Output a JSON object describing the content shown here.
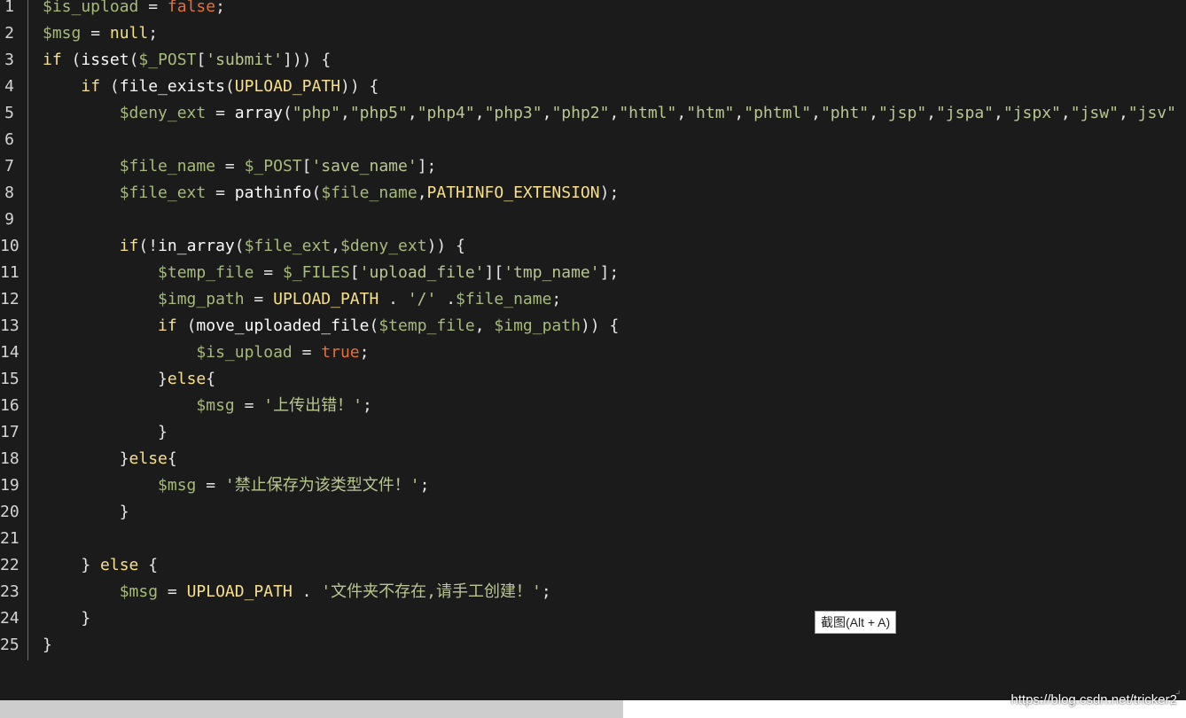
{
  "editor": {
    "line_numbers": [
      "1",
      "2",
      "3",
      "4",
      "5",
      "6",
      "7",
      "8",
      "9",
      "10",
      "11",
      "12",
      "13",
      "14",
      "15",
      "16",
      "17",
      "18",
      "19",
      "20",
      "21",
      "22",
      "23",
      "24",
      "25"
    ],
    "lines": [
      [
        [
          "var",
          "$is_upload"
        ],
        [
          "pn",
          " = "
        ],
        [
          "bool",
          "false"
        ],
        [
          "pn",
          ";"
        ]
      ],
      [
        [
          "var",
          "$msg"
        ],
        [
          "pn",
          " = "
        ],
        [
          "null",
          "null"
        ],
        [
          "pn",
          ";"
        ]
      ],
      [
        [
          "kw",
          "if"
        ],
        [
          "pn",
          " ("
        ],
        [
          "fn",
          "isset"
        ],
        [
          "pn",
          "("
        ],
        [
          "var",
          "$_POST"
        ],
        [
          "pn",
          "["
        ],
        [
          "str",
          "'submit'"
        ],
        [
          "pn",
          "])) {"
        ]
      ],
      [
        [
          "pn",
          "    "
        ],
        [
          "kw",
          "if"
        ],
        [
          "pn",
          " ("
        ],
        [
          "fn",
          "file_exists"
        ],
        [
          "pn",
          "("
        ],
        [
          "const",
          "UPLOAD_PATH"
        ],
        [
          "pn",
          ")) {"
        ]
      ],
      [
        [
          "pn",
          "        "
        ],
        [
          "var",
          "$deny_ext"
        ],
        [
          "pn",
          " = "
        ],
        [
          "fn",
          "array"
        ],
        [
          "pn",
          "("
        ],
        [
          "str",
          "\"php\""
        ],
        [
          "pn",
          ","
        ],
        [
          "str",
          "\"php5\""
        ],
        [
          "pn",
          ","
        ],
        [
          "str",
          "\"php4\""
        ],
        [
          "pn",
          ","
        ],
        [
          "str",
          "\"php3\""
        ],
        [
          "pn",
          ","
        ],
        [
          "str",
          "\"php2\""
        ],
        [
          "pn",
          ","
        ],
        [
          "str",
          "\"html\""
        ],
        [
          "pn",
          ","
        ],
        [
          "str",
          "\"htm\""
        ],
        [
          "pn",
          ","
        ],
        [
          "str",
          "\"phtml\""
        ],
        [
          "pn",
          ","
        ],
        [
          "str",
          "\"pht\""
        ],
        [
          "pn",
          ","
        ],
        [
          "str",
          "\"jsp\""
        ],
        [
          "pn",
          ","
        ],
        [
          "str",
          "\"jspa\""
        ],
        [
          "pn",
          ","
        ],
        [
          "str",
          "\"jspx\""
        ],
        [
          "pn",
          ","
        ],
        [
          "str",
          "\"jsw\""
        ],
        [
          "pn",
          ","
        ],
        [
          "str",
          "\"jsv\""
        ]
      ],
      [],
      [
        [
          "pn",
          "        "
        ],
        [
          "var",
          "$file_name"
        ],
        [
          "pn",
          " = "
        ],
        [
          "var",
          "$_POST"
        ],
        [
          "pn",
          "["
        ],
        [
          "str",
          "'save_name'"
        ],
        [
          "pn",
          "];"
        ]
      ],
      [
        [
          "pn",
          "        "
        ],
        [
          "var",
          "$file_ext"
        ],
        [
          "pn",
          " = "
        ],
        [
          "fn",
          "pathinfo"
        ],
        [
          "pn",
          "("
        ],
        [
          "var",
          "$file_name"
        ],
        [
          "pn",
          ","
        ],
        [
          "const",
          "PATHINFO_EXTENSION"
        ],
        [
          "pn",
          ");"
        ]
      ],
      [],
      [
        [
          "pn",
          "        "
        ],
        [
          "kw",
          "if"
        ],
        [
          "pn",
          "(!"
        ],
        [
          "fn",
          "in_array"
        ],
        [
          "pn",
          "("
        ],
        [
          "var",
          "$file_ext"
        ],
        [
          "pn",
          ","
        ],
        [
          "var",
          "$deny_ext"
        ],
        [
          "pn",
          ")) {"
        ]
      ],
      [
        [
          "pn",
          "            "
        ],
        [
          "var",
          "$temp_file"
        ],
        [
          "pn",
          " = "
        ],
        [
          "var",
          "$_FILES"
        ],
        [
          "pn",
          "["
        ],
        [
          "str",
          "'upload_file'"
        ],
        [
          "pn",
          "]["
        ],
        [
          "str",
          "'tmp_name'"
        ],
        [
          "pn",
          "];"
        ]
      ],
      [
        [
          "pn",
          "            "
        ],
        [
          "var",
          "$img_path"
        ],
        [
          "pn",
          " = "
        ],
        [
          "const",
          "UPLOAD_PATH"
        ],
        [
          "pn",
          " . "
        ],
        [
          "str",
          "'/'"
        ],
        [
          "pn",
          " ."
        ],
        [
          "var",
          "$file_name"
        ],
        [
          "pn",
          ";"
        ]
      ],
      [
        [
          "pn",
          "            "
        ],
        [
          "kw",
          "if"
        ],
        [
          "pn",
          " ("
        ],
        [
          "fn",
          "move_uploaded_file"
        ],
        [
          "pn",
          "("
        ],
        [
          "var",
          "$temp_file"
        ],
        [
          "pn",
          ", "
        ],
        [
          "var",
          "$img_path"
        ],
        [
          "pn",
          ")) {"
        ]
      ],
      [
        [
          "pn",
          "                "
        ],
        [
          "var",
          "$is_upload"
        ],
        [
          "pn",
          " = "
        ],
        [
          "bool",
          "true"
        ],
        [
          "pn",
          ";"
        ]
      ],
      [
        [
          "pn",
          "            }"
        ],
        [
          "kw",
          "else"
        ],
        [
          "pn",
          "{"
        ]
      ],
      [
        [
          "pn",
          "                "
        ],
        [
          "var",
          "$msg"
        ],
        [
          "pn",
          " = "
        ],
        [
          "str",
          "'上传出错！'"
        ],
        [
          "pn",
          ";"
        ]
      ],
      [
        [
          "pn",
          "            }"
        ]
      ],
      [
        [
          "pn",
          "        }"
        ],
        [
          "kw",
          "else"
        ],
        [
          "pn",
          "{"
        ]
      ],
      [
        [
          "pn",
          "            "
        ],
        [
          "var",
          "$msg"
        ],
        [
          "pn",
          " = "
        ],
        [
          "str",
          "'禁止保存为该类型文件！'"
        ],
        [
          "pn",
          ";"
        ]
      ],
      [
        [
          "pn",
          "        }"
        ]
      ],
      [],
      [
        [
          "pn",
          "    } "
        ],
        [
          "kw",
          "else"
        ],
        [
          "pn",
          " {"
        ]
      ],
      [
        [
          "pn",
          "        "
        ],
        [
          "var",
          "$msg"
        ],
        [
          "pn",
          " = "
        ],
        [
          "const",
          "UPLOAD_PATH"
        ],
        [
          "pn",
          " . "
        ],
        [
          "str",
          "'文件夹不存在,请手工创建！'"
        ],
        [
          "pn",
          ";"
        ]
      ],
      [
        [
          "pn",
          "    }"
        ]
      ],
      [
        [
          "pn",
          "}"
        ]
      ]
    ]
  },
  "tooltip": {
    "label": "截图(Alt + A)"
  },
  "watermark": {
    "text": "https://blog.csdn.net/tricker2"
  },
  "colors": {
    "background": "#1b1b1b",
    "variable": "#a6bb7a",
    "keyword": "#f7e08a",
    "string": "#b8c790",
    "boolean": "#e0713c"
  }
}
